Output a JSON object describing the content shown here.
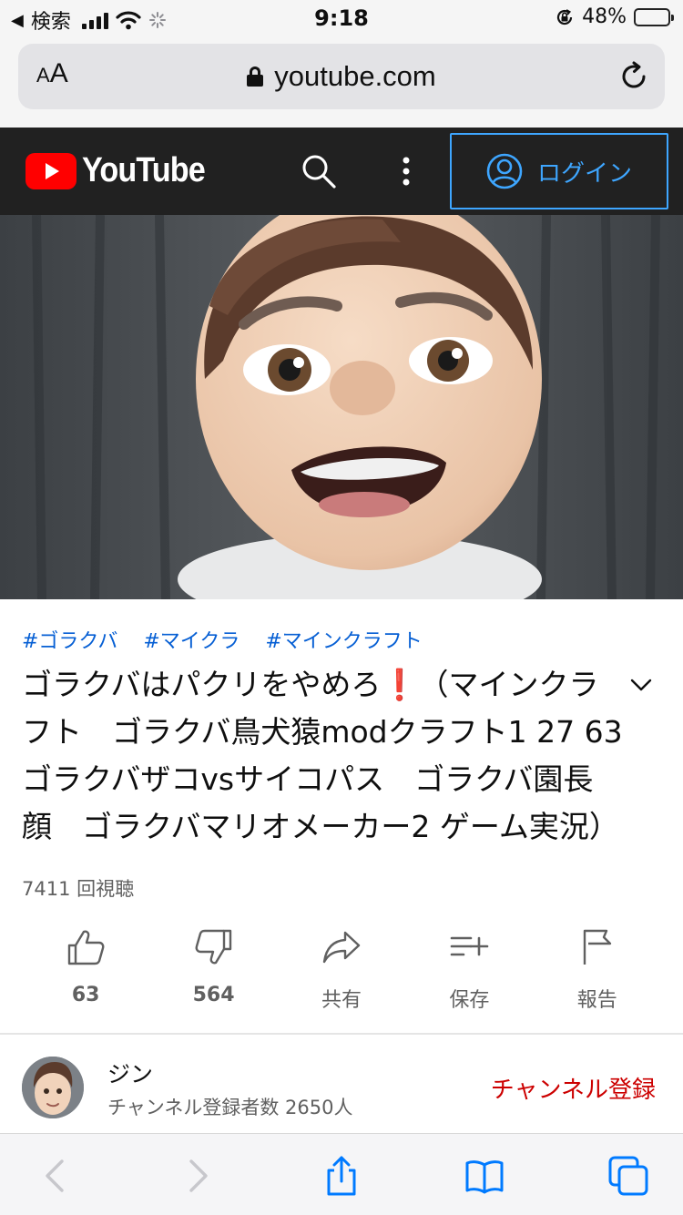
{
  "status_bar": {
    "back_app": "検索",
    "time": "9:18",
    "battery_percent": "48%",
    "battery_level": 0.48,
    "colors": {
      "battery": "#34c759"
    },
    "icons": [
      "back-arrow-icon",
      "signal-bars-icon",
      "wifi-icon",
      "loading-spinner-icon",
      "orientation-lock-icon",
      "battery-icon"
    ]
  },
  "browser": {
    "text_size_button": {
      "small": "A",
      "large": "A"
    },
    "url": "youtube.com",
    "icons": [
      "lock-icon",
      "reload-icon"
    ]
  },
  "youtube_header": {
    "logo_text": "YouTube",
    "login_label": "ログイン",
    "colors": {
      "background": "#212121",
      "logo_red": "#ff0000",
      "login_blue": "#3ea6ff"
    },
    "icons": [
      "search-icon",
      "more-vert-icon",
      "account-circle-icon"
    ]
  },
  "video": {
    "hashtags": [
      "#ゴラクバ",
      "#マイクラ",
      "#マインクラフト"
    ],
    "title": "ゴラクバはパクリをやめろ❗️（マインクラフト　ゴラクバ鳥犬猿modクラフト1 27 63 ゴラクバザコvsサイコパス　ゴラクバ園長顔　ゴラクバマリオメーカー2 ゲーム実況）",
    "views": "7411 回視聴",
    "actions": [
      {
        "icon": "thumb-up-icon",
        "label": "63"
      },
      {
        "icon": "thumb-down-icon",
        "label": "564"
      },
      {
        "icon": "share-icon",
        "label": "共有"
      },
      {
        "icon": "playlist-add-icon",
        "label": "保存"
      },
      {
        "icon": "flag-icon",
        "label": "報告"
      }
    ],
    "colors": {
      "hashtag": "#065fd4"
    }
  },
  "channel": {
    "name": "ジン",
    "subscribers": "チャンネル登録者数 2650人",
    "subscribe_label": "チャンネル登録",
    "colors": {
      "subscribe": "#cc0000"
    }
  },
  "safari_toolbar": {
    "icons": [
      "back-icon",
      "forward-icon",
      "share-icon",
      "bookmarks-icon",
      "tabs-icon"
    ],
    "colors": {
      "enabled": "#007aff",
      "disabled": "#c7c7cc"
    }
  }
}
